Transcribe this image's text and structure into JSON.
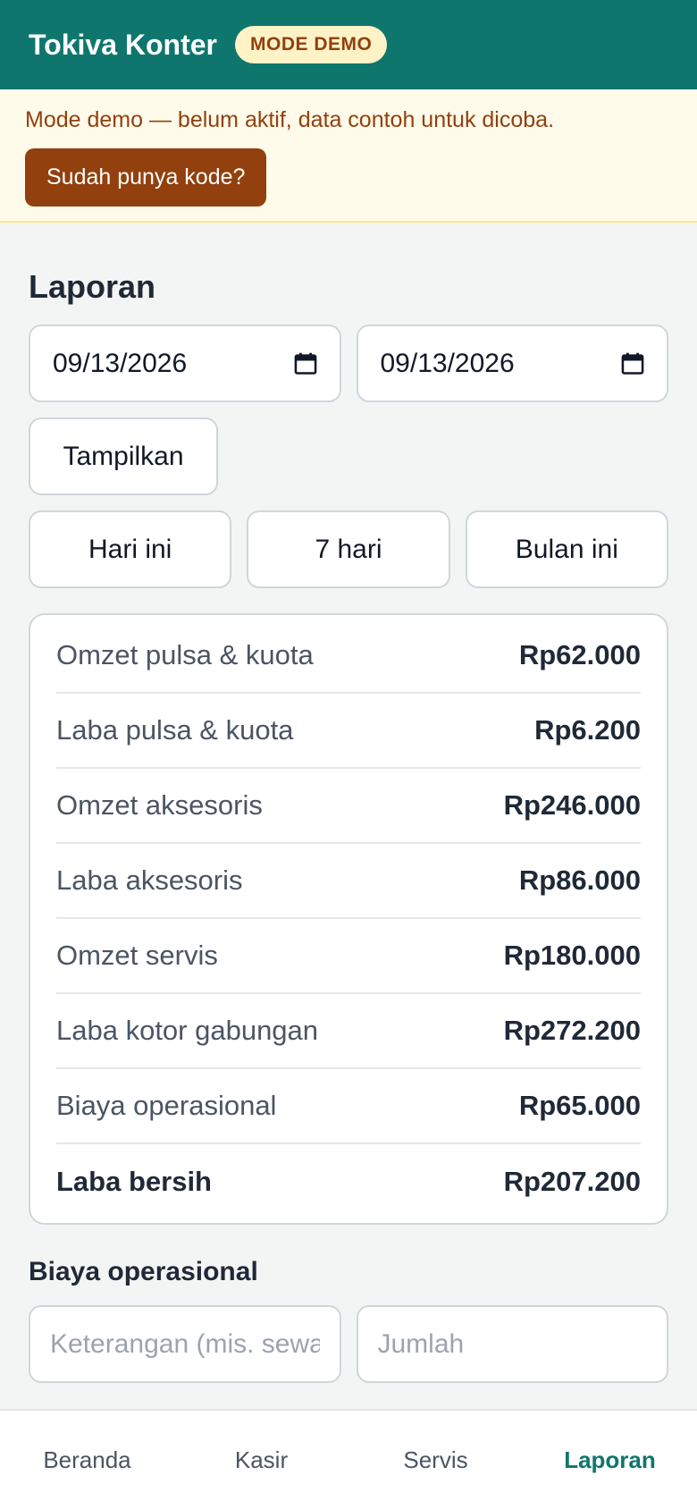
{
  "header": {
    "title": "Tokiva Konter",
    "badge": "MODE DEMO"
  },
  "banner": {
    "text": "Mode demo — belum aktif, data contoh untuk dicoba.",
    "button_label": "Sudah punya kode?"
  },
  "report": {
    "title": "Laporan",
    "date_from": "09/13/2026",
    "date_to": "09/13/2026",
    "show_label": "Tampilkan",
    "ranges": [
      "Hari ini",
      "7 hari",
      "Bulan ini"
    ],
    "summary": [
      {
        "label": "Omzet pulsa & kuota",
        "value": "Rp62.000"
      },
      {
        "label": "Laba pulsa & kuota",
        "value": "Rp6.200"
      },
      {
        "label": "Omzet aksesoris",
        "value": "Rp246.000"
      },
      {
        "label": "Laba aksesoris",
        "value": "Rp86.000"
      },
      {
        "label": "Omzet servis",
        "value": "Rp180.000"
      },
      {
        "label": "Laba kotor gabungan",
        "value": "Rp272.200"
      },
      {
        "label": "Biaya operasional",
        "value": "Rp65.000"
      },
      {
        "label": "Laba bersih",
        "value": "Rp207.200"
      }
    ]
  },
  "expense": {
    "title": "Biaya operasional",
    "description_placeholder": "Keterangan (mis. sewa)",
    "amount_placeholder": "Jumlah"
  },
  "nav": {
    "items": [
      "Beranda",
      "Kasir",
      "Servis",
      "Laporan"
    ],
    "active": "Laporan"
  },
  "colors": {
    "primary": "#0f766e",
    "demo_badge_bg": "#fef3c7",
    "demo_text": "#92400e",
    "banner_bg": "#fffbeb"
  },
  "icons": {
    "date_picker": "calendar-icon"
  }
}
